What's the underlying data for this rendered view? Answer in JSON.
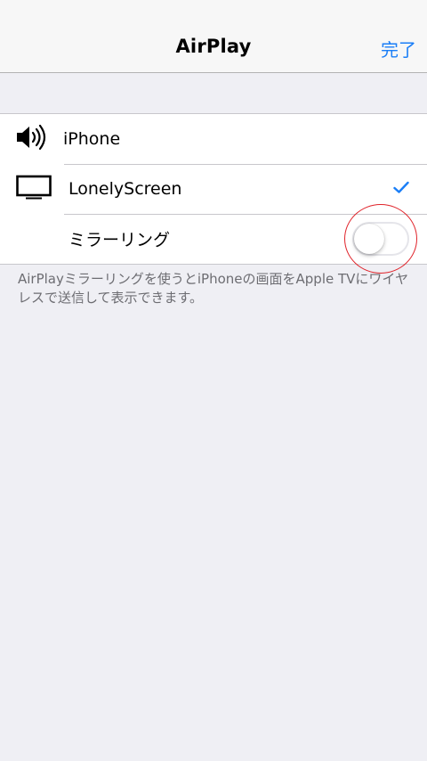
{
  "navbar": {
    "title": "AirPlay",
    "done_label": "完了"
  },
  "devices": [
    {
      "label": "iPhone",
      "icon": "speaker-icon",
      "selected": false
    },
    {
      "label": "LonelyScreen",
      "icon": "tv-icon",
      "selected": true
    }
  ],
  "mirroring": {
    "label": "ミラーリング",
    "enabled": false
  },
  "footer": {
    "note": "AirPlayミラーリングを使うとiPhoneの画面をApple TVにワイヤレスで送信して表示できます。"
  },
  "colors": {
    "accent": "#1a7ef7",
    "annotation": "#e0232a",
    "background": "#efeff4"
  }
}
